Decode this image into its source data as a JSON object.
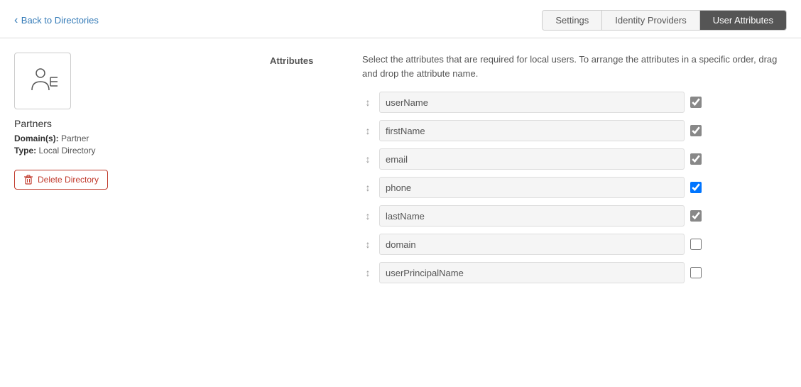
{
  "header": {
    "back_label": "Back to Directories",
    "tabs": [
      {
        "id": "settings",
        "label": "Settings",
        "active": false
      },
      {
        "id": "identity-providers",
        "label": "Identity Providers",
        "active": false
      },
      {
        "id": "user-attributes",
        "label": "User Attributes",
        "active": true
      }
    ]
  },
  "sidebar": {
    "directory_name": "Partners",
    "domain_label": "Domain(s):",
    "domain_value": "Partner",
    "type_label": "Type:",
    "type_value": "Local Directory",
    "delete_button": "Delete Directory"
  },
  "attributes_section": {
    "label": "Attributes",
    "description": "Select the attributes that are required for local users. To arrange the attributes in a specific order, drag and drop the attribute name.",
    "items": [
      {
        "name": "userName",
        "checked": true,
        "disabled": true
      },
      {
        "name": "firstName",
        "checked": true,
        "disabled": true
      },
      {
        "name": "email",
        "checked": true,
        "disabled": true
      },
      {
        "name": "phone",
        "checked": true,
        "disabled": false
      },
      {
        "name": "lastName",
        "checked": true,
        "disabled": true
      },
      {
        "name": "domain",
        "checked": false,
        "disabled": false
      },
      {
        "name": "userPrincipalName",
        "checked": false,
        "disabled": false
      }
    ]
  }
}
